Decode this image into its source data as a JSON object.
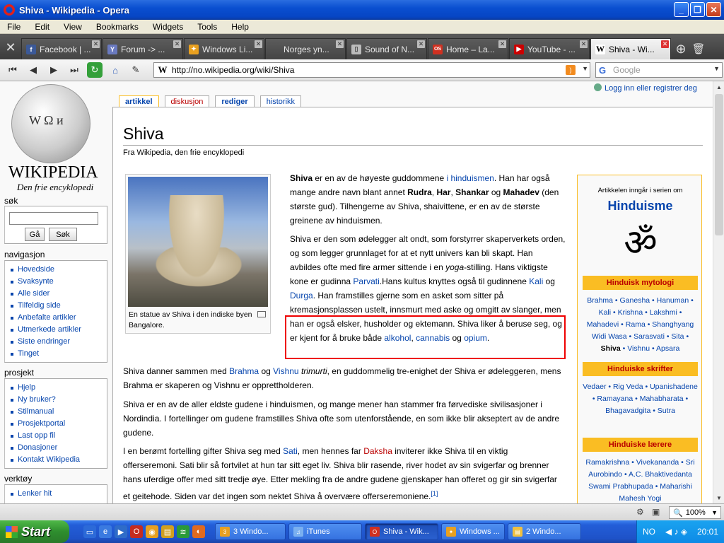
{
  "window": {
    "title": "Shiva - Wikipedia - Opera"
  },
  "menu": [
    "File",
    "Edit",
    "View",
    "Bookmarks",
    "Widgets",
    "Tools",
    "Help"
  ],
  "tabs": [
    {
      "label": "Facebook | ...",
      "icon": "facebook-icon",
      "color": "#3b5998",
      "glyph": "f"
    },
    {
      "label": "Forum -> ...",
      "icon": "forum-icon",
      "color": "#6a7ac0",
      "glyph": "Y"
    },
    {
      "label": "Windows Li...",
      "icon": "windows-live-icon",
      "color": "#e8a020",
      "glyph": "✦"
    },
    {
      "label": "Norges yn...",
      "icon": "page-icon",
      "color": "#888",
      "glyph": ""
    },
    {
      "label": "Sound of N...",
      "icon": "document-icon",
      "color": "#aaa",
      "glyph": "▯"
    },
    {
      "label": "Home – La...",
      "icon": "os-icon",
      "color": "#d03020",
      "glyph": "OS"
    },
    {
      "label": "YouTube - ...",
      "icon": "youtube-icon",
      "color": "#c00",
      "glyph": "▶"
    },
    {
      "label": "Shiva - Wi...",
      "icon": "wikipedia-icon",
      "color": "#fff",
      "glyph": "W",
      "active": true
    }
  ],
  "address": {
    "url": "http://no.wikipedia.org/wiki/Shiva",
    "search_placeholder": "Google"
  },
  "sidebar": {
    "logo_name": "WIKIPEDIA",
    "logo_sub": "Den frie encyklopedi",
    "search_heading": "søk",
    "go_label": "Gå",
    "search_label": "Søk",
    "nav_heading": "navigasjon",
    "nav": [
      "Hovedside",
      "Svaksynte",
      "Alle sider",
      "Tilfeldig side",
      "Anbefalte artikler",
      "Utmerkede artikler",
      "Siste endringer",
      "Tinget"
    ],
    "project_heading": "prosjekt",
    "project": [
      "Hjelp",
      "Ny bruker?",
      "Stilmanual",
      "Prosjektportal",
      "Last opp fil",
      "Donasjoner",
      "Kontakt Wikipedia"
    ],
    "tools_heading": "verktøy",
    "tools": [
      "Lenker hit"
    ]
  },
  "page_tabs": {
    "article": "artikkel",
    "discussion": "diskusjon",
    "edit": "rediger",
    "history": "historikk"
  },
  "login": "Logg inn eller registrer deg",
  "article": {
    "title": "Shiva",
    "from": "Fra Wikipedia, den frie encyklopedi",
    "caption": "En statue av Shiva i den indiske byen Bangalore.",
    "p1": {
      "b1": "Shiva",
      "t1": " er en av de høyeste guddommene ",
      "l1": "i hinduismen",
      "t2": ". Han har også mange andre navn blant annet ",
      "b2": "Rudra",
      "t3": ", ",
      "b3": "Har",
      "t4": ", ",
      "b4": "Shankar",
      "t5": " og ",
      "b5": "Mahadev",
      "t6": " (den største gud). Tilhengerne av Shiva, shaivittene, er en av de største greinene av hinduismen."
    },
    "p2": {
      "t1": "Shiva er den som ødelegger alt ondt, som forstyrrer skaperverkets orden, og som legger grunnlaget for at et nytt univers kan bli skapt. Han avbildes ofte med fire armer sittende i en ",
      "i1": "yoga",
      "t2": "-stilling. Hans viktigste kone er gudinna ",
      "l1": "Parvati",
      "t3": ".Hans kultus knyttes også til gudinnene ",
      "l2": "Kali",
      "t4": " og ",
      "l3": "Durga",
      "t5": ". Han framstilles gjerne som en asket som sitter på kremasjonsplassen ustelt, innsmurt med aske og omgitt av slanger, men han er også elsker, husholder og ektemann. Shiva liker å beruse seg, og er kjent for å bruke både ",
      "l4": "alkohol",
      "t6": ", ",
      "l5": "cannabis",
      "t7": " og ",
      "l6": "opium",
      "t8": "."
    },
    "p3": {
      "t1": "Shiva danner sammen med ",
      "l1": "Brahma",
      "t2": " og ",
      "l2": "Vishnu",
      "i1": " trimurti",
      "t3": ", en guddommelig tre-enighet der Shiva er ødeleggeren, mens Brahma er skaperen og Vishnu er opprettholderen."
    },
    "p4": "Shiva er en av de aller eldste gudene i hinduismen, og mange mener han stammer fra førvediske sivilisasjoner i Nordindia. I fortellinger om gudene framstilles Shiva ofte som utenforstående, en som ikke blir akseptert av de andre gudene.",
    "p5": {
      "t1": "I en berømt fortelling gifter Shiva seg med ",
      "l1": "Sati",
      "t2": ", men hennes far ",
      "r1": "Daksha",
      "t3": " inviterer ikke Shiva til en viktig offerseremoni. Sati blir så fortvilet at hun tar sitt eget liv. Shiva blir rasende, river hodet av sin svigerfar og brenner hans uferdige offer med sitt tredje øye. Etter mekling fra de andre gudene gjenskaper han offeret og gir sin svigerfar et geitehode. Siden var det ingen som nektet Shiva å overvære offerseremoniene.",
      "sup": "[1]"
    }
  },
  "infobox": {
    "pre": "Artikkelen inngår i serien om",
    "title": "Hinduisme",
    "om": "ॐ",
    "sec1": "Hinduisk mytologi",
    "list1": "Brahma • Ganesha • Hanuman • Kali • Krishna • Lakshmi • Mahadevi • Rama • Shanghyang Widi Wasa • Sarasvati • Sita •",
    "list1_bold": "Shiva",
    "list1_end": " • Vishnu • Apsara",
    "sec2": "Hinduiske skrifter",
    "list2": "Vedaer • Rig Veda • Upanishadene • Ramayana • Mahabharata • Bhagavadgita • Sutra",
    "sec3": "Hinduiske lærere",
    "list3": "Ramakrishna • Vivekananda • Sri Aurobindo • A.C. Bhaktivedanta Swami Prabhupada • Maharishi Mahesh Yogi"
  },
  "status": {
    "zoom": "100%"
  },
  "taskbar": {
    "start": "Start",
    "items": [
      {
        "label": "3 Windo...",
        "icon": "windows-explorer-icon"
      },
      {
        "label": "iTunes",
        "icon": "itunes-icon"
      },
      {
        "label": "Shiva - Wik...",
        "icon": "opera-icon",
        "active": true
      },
      {
        "label": "Windows ...",
        "icon": "windows-live-icon"
      },
      {
        "label": "2 Windo...",
        "icon": "folder-icon"
      }
    ],
    "lang": "NO",
    "clock": "20:01"
  }
}
